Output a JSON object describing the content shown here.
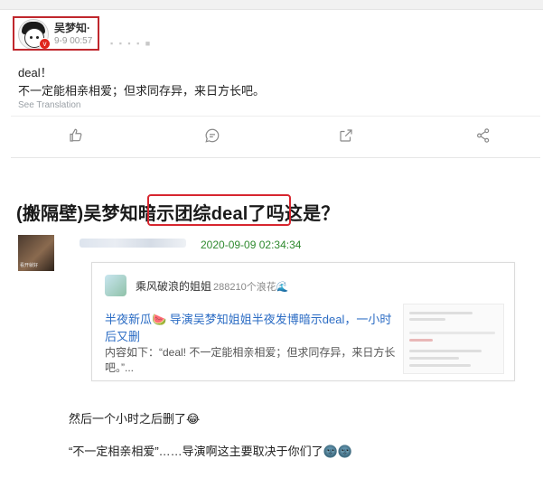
{
  "post": {
    "username": "吴梦知·",
    "date": "9-9 00:57",
    "blurred_meta": "▪ ▪ ▪ ▪ ■",
    "verified_mark": "v",
    "text_line1": "deal！",
    "text_line2": "不一定能相亲相爱；但求同存异，来日方长吧。",
    "translation_link": "See Translation",
    "actions": [
      "like-icon",
      "comment-icon",
      "share-icon",
      "network-icon"
    ]
  },
  "article": {
    "headline": "(搬隔壁)吴梦知暗示团综deal了吗这是？",
    "thumb_caption": "看开就好",
    "timestamp": "2020-09-09 02:34:34",
    "card": {
      "name": "乘风破浪的姐姐",
      "count": "288210个浪花🌊",
      "title_line1": "半夜新瓜🍉  导演吴梦知姐姐半夜发博暗示deal，一小时",
      "title_line2": "后又删",
      "body_line1": "内容如下：“deal!  不一定能相亲相爱；但求同存异，来日方长",
      "body_line2": "吧。”..."
    },
    "sentence1": "然后一个小时之后删了😂",
    "sentence2": "“不一定相亲相爱”……导演啊这主要取决于你们了🌚🌚"
  },
  "colors": {
    "highlight_border": "#d7262f",
    "link_blue": "#2b6cc4",
    "timestamp_green": "#2f8a2f"
  }
}
